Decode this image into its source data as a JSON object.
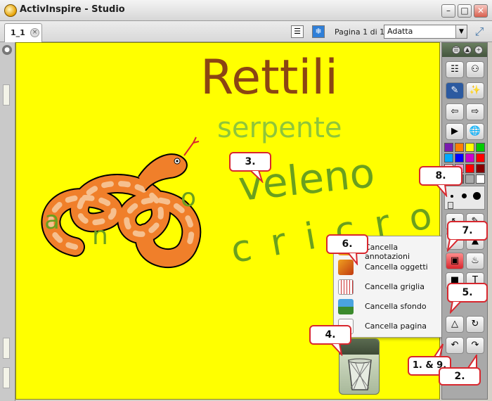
{
  "window": {
    "title": "ActivInspire - Studio"
  },
  "tabs": [
    {
      "label": "1_1"
    }
  ],
  "toolbar": {
    "page_indicator": "Pagina 1 di 1",
    "zoom_value": "Adatta"
  },
  "canvas": {
    "title": "Rettili",
    "words": [
      "serpente",
      "veleno",
      "c r i c r o"
    ],
    "snake_letters": [
      "a",
      "n",
      "o"
    ]
  },
  "context_menu": {
    "items": [
      {
        "label": "Cancella annotazioni",
        "icon": "eraser-annotations-icon"
      },
      {
        "label": "Cancella oggetti",
        "icon": "eraser-objects-icon"
      },
      {
        "label": "Cancella griglia",
        "icon": "eraser-grid-icon"
      },
      {
        "label": "Cancella sfondo",
        "icon": "eraser-background-icon"
      },
      {
        "label": "Cancella pagina",
        "icon": "eraser-page-icon"
      }
    ]
  },
  "callouts": [
    "1. & 9.",
    "2.",
    "3.",
    "4.",
    "5.",
    "6.",
    "7.",
    "8."
  ],
  "palette": [
    "#7a1cae",
    "#ff7f00",
    "#ffff00",
    "#00cc00",
    "#00aaff",
    "#0000ff",
    "#cc00cc",
    "#ff0000",
    "#ffcccc",
    "#ff99cc",
    "#ff0000",
    "#880000",
    "#000000",
    "#666666",
    "#aaaaaa",
    "#ffffff"
  ],
  "colors": {
    "canvas_bg": "#ffff00",
    "callout_border": "#d8272e",
    "title_ink": "#8b4513",
    "word_ink": "#6aa01e"
  }
}
